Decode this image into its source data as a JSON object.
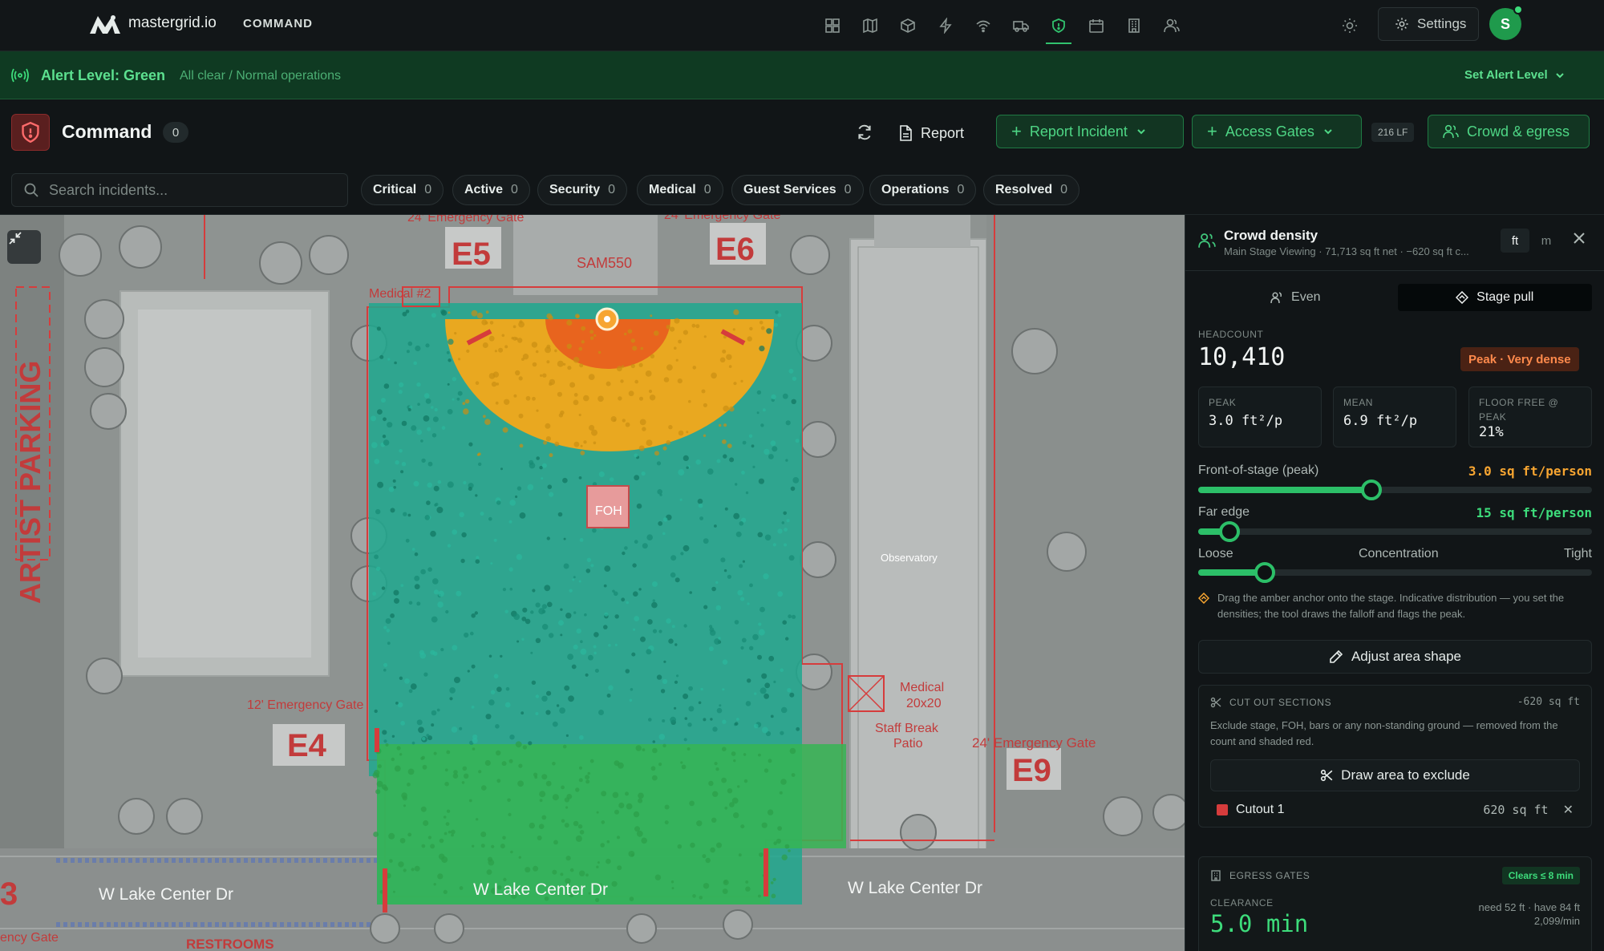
{
  "nav": {
    "brand": "mastergrid.io",
    "section": "COMMAND",
    "icons": [
      "dashboard-icon",
      "map-icon",
      "cube-icon",
      "power-icon",
      "wifi-icon",
      "truck-icon",
      "shield-icon",
      "calendar-icon",
      "building-icon",
      "users-icon"
    ],
    "active_icon": "shield-icon",
    "settings_label": "Settings",
    "avatar_initial": "S"
  },
  "alert": {
    "level": "Alert Level: Green",
    "description": "All clear / Normal operations",
    "set_label": "Set Alert Level"
  },
  "command": {
    "title": "Command",
    "count": "0",
    "report_label": "Report",
    "report_incident_label": "Report Incident",
    "access_gates_label": "Access Gates",
    "lf_badge": "216 LF",
    "crowd_egress_label": "Crowd & egress"
  },
  "search": {
    "placeholder": "Search incidents..."
  },
  "filters": [
    {
      "label": "Critical",
      "count": "0"
    },
    {
      "label": "Active",
      "count": "0"
    },
    {
      "label": "Security",
      "count": "0"
    },
    {
      "label": "Medical",
      "count": "0"
    },
    {
      "label": "Guest Services",
      "count": "0"
    },
    {
      "label": "Operations",
      "count": "0"
    },
    {
      "label": "Resolved",
      "count": "0"
    }
  ],
  "map": {
    "labels": {
      "artist_parking": "ARTIST PARKING",
      "e5": "E5",
      "e6": "E6",
      "e4": "E4",
      "e9": "E9",
      "e3": "3",
      "sam": "SAM550",
      "foh": "FOH",
      "medical2": "Medical #2",
      "gate_top_left": "24' Emergency Gate",
      "gate_top_right": "24' Emergency Gate",
      "gate_12": "12' Emergency Gate",
      "gate_24_right": "24' Emergency Gate",
      "gate_bottom_left": "ency Gate",
      "medical_tent": "Medical",
      "medical_size": "20x20",
      "staff_break": "Staff Break",
      "patio": "Patio",
      "observatory": "Observatory",
      "street_left": "W Lake Center Dr",
      "street_mid": "W Lake Center Dr",
      "street_right": "W Lake Center Dr",
      "restrooms": "RESTROOMS"
    },
    "colors": {
      "very_dense": "#e8641e",
      "dense": "#e9a820",
      "normal": "#1fa88e",
      "loose": "#36b553",
      "boundary": "#d63c3c"
    }
  },
  "panel": {
    "title": "Crowd density",
    "subtitle": "Main Stage Viewing · 71,713 sq ft net · −620 sq ft c...",
    "unit_ft": "ft",
    "unit_m": "m",
    "mode_even": "Even",
    "mode_stage": "Stage pull",
    "headcount_label": "HEADCOUNT",
    "headcount": "10,410",
    "peak_badge": "Peak · Very dense",
    "stats": [
      {
        "label": "PEAK",
        "value": "3.0 ft²/p"
      },
      {
        "label": "MEAN",
        "value": "6.9 ft²/p"
      },
      {
        "label": "FLOOR FREE @ PEAK",
        "value": "21%"
      }
    ],
    "front_label": "Front-of-stage (peak)",
    "front_value": "3.0 sq ft/person",
    "front_fraction": 0.44,
    "far_label": "Far edge",
    "far_value": "15 sq ft/person",
    "far_fraction": 0.08,
    "loose_label": "Loose",
    "concentration_label": "Concentration",
    "tight_label": "Tight",
    "concentration_fraction": 0.17,
    "hint": "Drag the amber anchor onto the stage. Indicative distribution — you set the densities; the tool draws the falloff and flags the peak.",
    "adjust_label": "Adjust area shape",
    "cut_header": "CUT OUT SECTIONS",
    "cut_area": "-620 sq ft",
    "cut_desc": "Exclude stage, FOH, bars or any non-standing ground — removed from the count and shaded red.",
    "draw_label": "Draw area to exclude",
    "cutout_name": "Cutout 1",
    "cutout_size": "620 sq ft",
    "egress_header": "EGRESS GATES",
    "egress_badge": "Clears ≤ 8 min",
    "clearance_label": "CLEARANCE",
    "clearance_value": "5.0 min",
    "egress_need": "need 52 ft · have 84 ft",
    "egress_rate": "2,099/min"
  }
}
